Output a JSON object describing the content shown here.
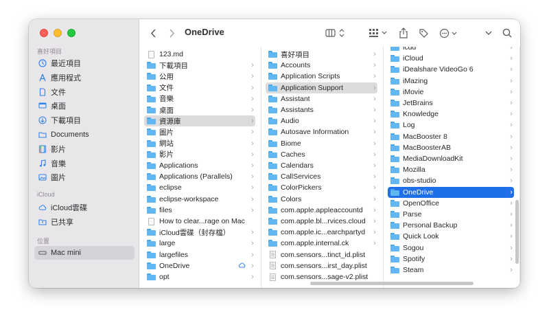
{
  "window": {
    "title": "OneDrive"
  },
  "sidebar": {
    "sections": [
      {
        "label": "喜好項目",
        "items": [
          {
            "label": "最近項目",
            "icon": "clock-icon"
          },
          {
            "label": "應用程式",
            "icon": "applications-icon"
          },
          {
            "label": "文件",
            "icon": "document-icon"
          },
          {
            "label": "桌面",
            "icon": "desktop-icon"
          },
          {
            "label": "下載項目",
            "icon": "download-icon"
          },
          {
            "label": "Documents",
            "icon": "folder-icon"
          },
          {
            "label": "影片",
            "icon": "film-icon"
          },
          {
            "label": "音樂",
            "icon": "music-icon"
          },
          {
            "label": "圖片",
            "icon": "photo-icon"
          }
        ]
      },
      {
        "label": "iCloud",
        "items": [
          {
            "label": "iCloud雲碟",
            "icon": "icloud-icon"
          },
          {
            "label": "已共享",
            "icon": "shared-folder-icon"
          }
        ]
      },
      {
        "label": "位置",
        "items": [
          {
            "label": "Mac mini",
            "icon": "computer-icon"
          }
        ]
      }
    ]
  },
  "columns": [
    {
      "items": [
        {
          "name": "123.md",
          "type": "doc",
          "chevron": false
        },
        {
          "name": "下載項目",
          "type": "folder",
          "chevron": true
        },
        {
          "name": "公用",
          "type": "folder",
          "chevron": true
        },
        {
          "name": "文件",
          "type": "folder",
          "chevron": true
        },
        {
          "name": "音樂",
          "type": "folder",
          "chevron": true
        },
        {
          "name": "桌面",
          "type": "folder",
          "chevron": true
        },
        {
          "name": "資源庫",
          "type": "folder",
          "chevron": true,
          "state": "grey"
        },
        {
          "name": "圖片",
          "type": "folder",
          "chevron": true
        },
        {
          "name": "網站",
          "type": "folder",
          "chevron": true
        },
        {
          "name": "影片",
          "type": "folder",
          "chevron": true
        },
        {
          "name": "Applications",
          "type": "folder",
          "chevron": true
        },
        {
          "name": "Applications (Parallels)",
          "type": "folder",
          "chevron": true
        },
        {
          "name": "eclipse",
          "type": "folder",
          "chevron": true
        },
        {
          "name": "eclipse-workspace",
          "type": "folder",
          "chevron": true
        },
        {
          "name": "files",
          "type": "folder",
          "chevron": true
        },
        {
          "name": "How to clear...rage on Mac",
          "type": "doc",
          "chevron": false
        },
        {
          "name": "iCloud雲碟（封存檔）",
          "type": "folder",
          "chevron": true
        },
        {
          "name": "large",
          "type": "folder",
          "chevron": true
        },
        {
          "name": "largefiles",
          "type": "folder",
          "chevron": true
        },
        {
          "name": "OneDrive",
          "type": "folder",
          "chevron": true,
          "cloud": true
        },
        {
          "name": "opt",
          "type": "folder",
          "chevron": true
        }
      ]
    },
    {
      "items": [
        {
          "name": "喜好項目",
          "type": "folder",
          "chevron": true
        },
        {
          "name": "Accounts",
          "type": "folder",
          "chevron": true
        },
        {
          "name": "Application Scripts",
          "type": "folder",
          "chevron": true
        },
        {
          "name": "Application Support",
          "type": "folder",
          "chevron": true,
          "state": "grey"
        },
        {
          "name": "Assistant",
          "type": "folder",
          "chevron": true
        },
        {
          "name": "Assistants",
          "type": "folder",
          "chevron": true
        },
        {
          "name": "Audio",
          "type": "folder",
          "chevron": true
        },
        {
          "name": "Autosave Information",
          "type": "folder",
          "chevron": true
        },
        {
          "name": "Biome",
          "type": "folder",
          "chevron": true
        },
        {
          "name": "Caches",
          "type": "folder",
          "chevron": true
        },
        {
          "name": "Calendars",
          "type": "folder",
          "chevron": true
        },
        {
          "name": "CallServices",
          "type": "folder",
          "chevron": true
        },
        {
          "name": "ColorPickers",
          "type": "folder",
          "chevron": true
        },
        {
          "name": "Colors",
          "type": "folder",
          "chevron": true
        },
        {
          "name": "com.apple.appleaccountd",
          "type": "folder",
          "chevron": true
        },
        {
          "name": "com.apple.bl...rvices.cloud",
          "type": "folder",
          "chevron": true
        },
        {
          "name": "com.apple.ic...earchpartyd",
          "type": "folder",
          "chevron": true
        },
        {
          "name": "com.apple.internal.ck",
          "type": "folder",
          "chevron": true
        },
        {
          "name": "com.sensors...tinct_id.plist",
          "type": "plist",
          "chevron": false
        },
        {
          "name": "com.sensors...irst_day.plist",
          "type": "plist",
          "chevron": false
        },
        {
          "name": "com.sensors...sage-v2.plist",
          "type": "plist",
          "chevron": false
        }
      ]
    },
    {
      "items": [
        {
          "name": "icdd",
          "type": "folder",
          "chevron": true
        },
        {
          "name": "iCloud",
          "type": "folder",
          "chevron": true
        },
        {
          "name": "iDealshare VideoGo 6",
          "type": "folder",
          "chevron": true
        },
        {
          "name": "iMazing",
          "type": "folder",
          "chevron": true
        },
        {
          "name": "iMovie",
          "type": "folder",
          "chevron": true
        },
        {
          "name": "JetBrains",
          "type": "folder",
          "chevron": true
        },
        {
          "name": "Knowledge",
          "type": "folder",
          "chevron": true
        },
        {
          "name": "Log",
          "type": "folder",
          "chevron": true
        },
        {
          "name": "MacBooster 8",
          "type": "folder",
          "chevron": true
        },
        {
          "name": "MacBoosterAB",
          "type": "folder",
          "chevron": true
        },
        {
          "name": "MediaDownloadKit",
          "type": "folder",
          "chevron": true
        },
        {
          "name": "Mozilla",
          "type": "folder",
          "chevron": true
        },
        {
          "name": "obs-studio",
          "type": "folder",
          "chevron": true
        },
        {
          "name": "OneDrive",
          "type": "folder",
          "chevron": true,
          "state": "blue"
        },
        {
          "name": "OpenOffice",
          "type": "folder",
          "chevron": true
        },
        {
          "name": "Parse",
          "type": "folder",
          "chevron": true
        },
        {
          "name": "Personal Backup",
          "type": "folder",
          "chevron": true
        },
        {
          "name": "Quick Look",
          "type": "folder",
          "chevron": true
        },
        {
          "name": "Sogou",
          "type": "folder",
          "chevron": true
        },
        {
          "name": "Spotify",
          "type": "folder",
          "chevron": true
        },
        {
          "name": "Steam",
          "type": "folder",
          "chevron": true
        }
      ]
    }
  ],
  "colors": {
    "accent": "#1f6fe8",
    "folder": "#62b6f2"
  }
}
